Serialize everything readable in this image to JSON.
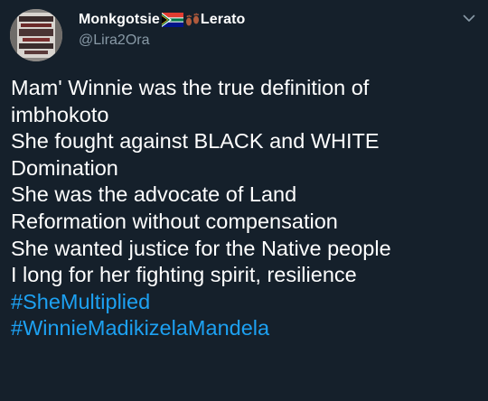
{
  "theme": {
    "background": "#15202b",
    "text": "#ffffff",
    "secondary_text": "#8899a6",
    "link": "#1da1f2"
  },
  "author": {
    "name_part1": "Monkgotsie",
    "flag_icon": "south-africa-flag-icon",
    "feet_icon": "footprints-icon",
    "name_part2": "Lerato",
    "handle": "@Lira2Ora",
    "avatar_icon": "avatar-image"
  },
  "menu": {
    "caret_icon": "chevron-down-icon"
  },
  "tweet": {
    "lines": [
      "Mam' Winnie was the true definition of",
      "imbhokoto",
      "She fought against BLACK and WHITE",
      "Domination",
      "She was the advocate of Land",
      "Reformation without compensation",
      "She wanted justice for the Native people",
      "I long for her fighting spirit, resilience"
    ],
    "hashtags": [
      "#SheMultiplied",
      "#WinnieMadikizelaMandela"
    ]
  }
}
